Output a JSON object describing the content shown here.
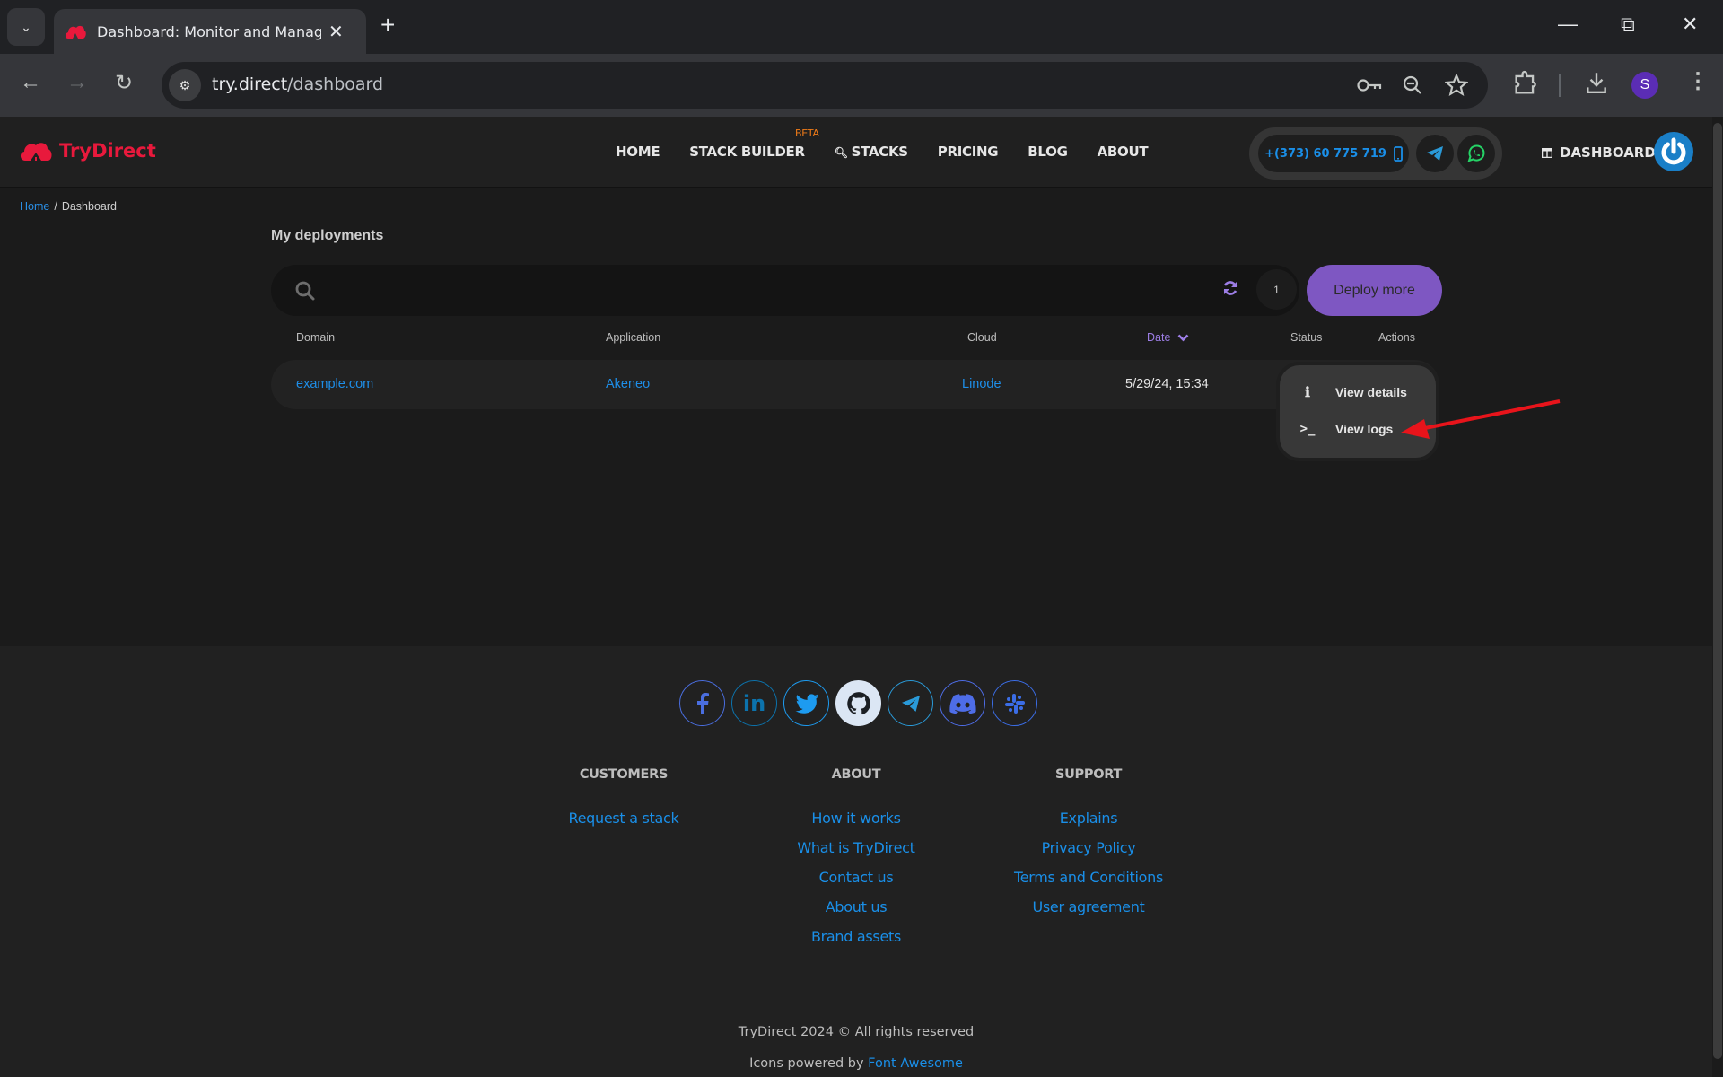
{
  "browser": {
    "tab_title": "Dashboard: Monitor and Manage",
    "url_host": "try.direct",
    "url_path": "/dashboard",
    "profile_initial": "S",
    "accent_profile": "#5b2db5"
  },
  "header": {
    "logo_text": "TryDirect",
    "brand_color": "#e8193c",
    "nav": [
      {
        "label": "HOME"
      },
      {
        "label": "STACK BUILDER",
        "badge": "BETA"
      },
      {
        "label": "STACKS",
        "icon": "search-icon"
      },
      {
        "label": "PRICING"
      },
      {
        "label": "BLOG"
      },
      {
        "label": "ABOUT"
      }
    ],
    "phone": "+(373) 60 775 719",
    "dashboard_label": "DASHBOARD"
  },
  "breadcrumb": {
    "home": "Home",
    "separator": "/",
    "current": "Dashboard"
  },
  "deployments": {
    "title": "My deployments",
    "search_placeholder": "",
    "search_value": "",
    "count": "1",
    "deploy_more_label": "Deploy more",
    "columns": {
      "domain": "Domain",
      "application": "Application",
      "cloud": "Cloud",
      "date": "Date",
      "status": "Status",
      "actions": "Actions"
    },
    "sort": {
      "column": "Date",
      "direction": "descending"
    },
    "rows": [
      {
        "domain": "example.com",
        "application": "Akeneo",
        "cloud": "Linode",
        "date": "5/29/24, 15:34",
        "status": ""
      }
    ],
    "actions_menu": [
      {
        "label": "View details",
        "icon": "info-icon"
      },
      {
        "label": "View logs",
        "icon": "terminal-icon"
      }
    ],
    "annotation_arrow_color": "#e8141b"
  },
  "footer": {
    "socials": [
      "facebook",
      "linkedin",
      "twitter",
      "github",
      "telegram",
      "discord",
      "slack"
    ],
    "columns": [
      {
        "heading": "CUSTOMERS",
        "links": [
          "Request a stack"
        ]
      },
      {
        "heading": "ABOUT",
        "links": [
          "How it works",
          "What is TryDirect",
          "Contact us",
          "About us",
          "Brand assets"
        ]
      },
      {
        "heading": "SUPPORT",
        "links": [
          "Explains",
          "Privacy Policy",
          "Terms and Conditions",
          "User agreement"
        ]
      }
    ],
    "copyright": "TryDirect 2024 © All rights reserved",
    "powered_prefix": "Icons powered by ",
    "powered_link": "Font Awesome"
  }
}
